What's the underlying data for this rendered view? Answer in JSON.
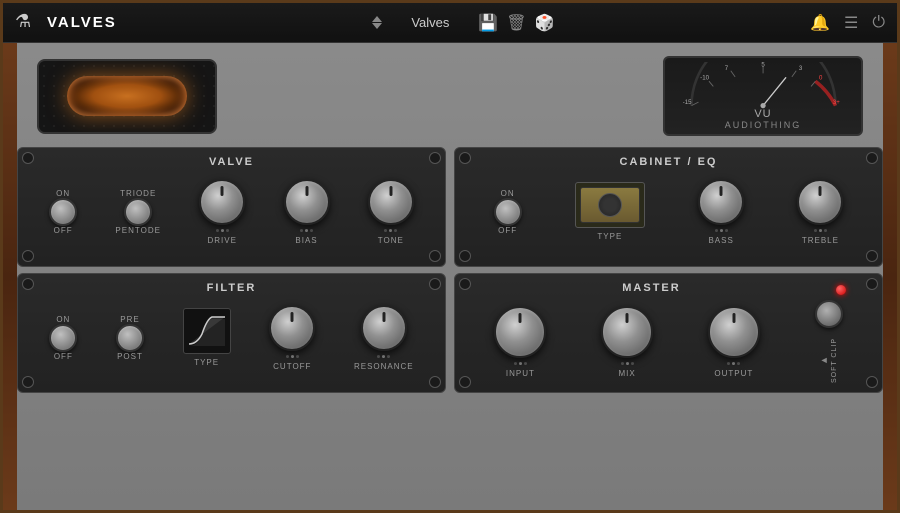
{
  "app": {
    "title": "VALVES",
    "preset_name": "Valves",
    "icon": "⚗"
  },
  "toolbar": {
    "save_icon": "💾",
    "delete_icon": "🗑",
    "random_icon": "🎲",
    "bell_icon": "🔔",
    "menu_icon": "☰",
    "power_icon": "⏻"
  },
  "vu": {
    "label": "VU",
    "brand": "AUDIOTHING",
    "scale": [
      "-15",
      "-10",
      "7",
      "5",
      "3",
      "0",
      "3+"
    ]
  },
  "valve_panel": {
    "title": "VALVE",
    "on_label": "ON",
    "off_label": "OFF",
    "triode_label": "TRIODE",
    "pentode_label": "PENTODE",
    "drive_label": "DRIVE",
    "bias_label": "BIAS",
    "tone_label": "TONE"
  },
  "cabinet_panel": {
    "title": "CABINET / EQ",
    "on_label": "ON",
    "off_label": "OFF",
    "type_label": "TYPE",
    "bass_label": "BASS",
    "treble_label": "TREBLE"
  },
  "filter_panel": {
    "title": "FILTER",
    "on_label": "ON",
    "off_label": "OFF",
    "pre_label": "PRE",
    "post_label": "POST",
    "type_label": "TYPE",
    "cutoff_label": "CUTOFF",
    "resonance_label": "RESONANCE"
  },
  "master_panel": {
    "title": "MASTER",
    "input_label": "INPUT",
    "mix_label": "MIX",
    "output_label": "OUTPUT",
    "soft_clip_label": "SOFT CLIP"
  }
}
